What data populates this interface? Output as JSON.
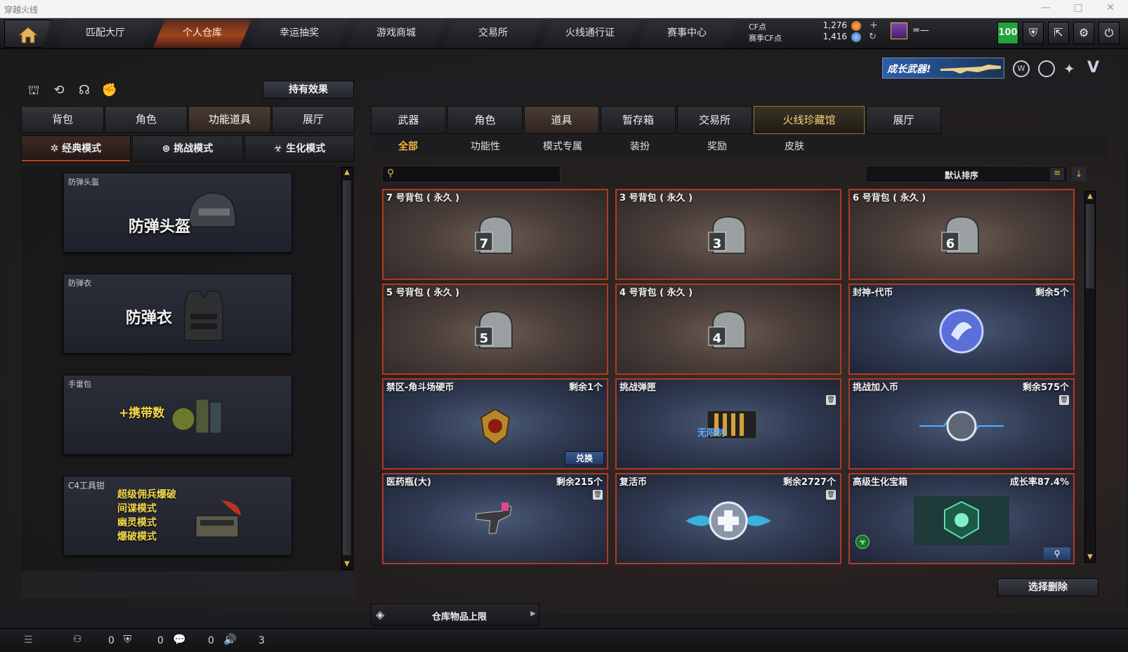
{
  "window": {
    "title": "穿越火线",
    "minimize": "—",
    "maximize": "□",
    "close": "✕"
  },
  "nav": {
    "tabs": [
      "匹配大厅",
      "个人仓库",
      "幸运抽奖",
      "游戏商城",
      "交易所",
      "火线通行证",
      "赛事中心"
    ],
    "active": "个人仓库",
    "cf_label": "CF点",
    "season_cf_label": "赛季CF点",
    "cf_value": "1,276",
    "season_cf_value": "1,416",
    "rank_text": "=—",
    "level_badge": "100"
  },
  "banner": {
    "text": "成长武器!"
  },
  "left": {
    "effect_button": "持有效果",
    "tabs": [
      "背包",
      "角色",
      "功能道具",
      "展厅"
    ],
    "active_tab": "功能道具",
    "modes": [
      "经典模式",
      "挑战模式",
      "生化模式"
    ],
    "active_mode": "经典模式",
    "cards": [
      {
        "label": "防弹头盔",
        "title": "防弹头盔"
      },
      {
        "label": "防弹衣",
        "title": "防弹衣"
      },
      {
        "label": "手雷包",
        "title": "+携带数"
      },
      {
        "label": "C4工具钳",
        "lines": [
          "超级佣兵爆破",
          "间谍模式",
          "幽灵模式",
          "爆破模式"
        ]
      }
    ]
  },
  "right": {
    "tabs": [
      "武器",
      "角色",
      "道具",
      "暂存箱",
      "交易所",
      "火线珍藏馆",
      "展厅"
    ],
    "active_tab": "道具",
    "subtabs": [
      "全部",
      "功能性",
      "模式专属",
      "装扮",
      "奖励",
      "皮肤"
    ],
    "active_subtab": "全部",
    "search_placeholder": "",
    "sort_label": "默认排序",
    "items": [
      {
        "name": "7 号背包 ( 永久 )",
        "count": "",
        "bag": "7",
        "style": "brown"
      },
      {
        "name": "3 号背包 ( 永久 )",
        "count": "",
        "bag": "3",
        "style": "brown"
      },
      {
        "name": "6 号背包 ( 永久 )",
        "count": "",
        "bag": "6",
        "style": "brown"
      },
      {
        "name": "5 号背包 ( 永久 )",
        "count": "",
        "bag": "5",
        "style": "brown"
      },
      {
        "name": "4 号背包 ( 永久 )",
        "count": "",
        "bag": "4",
        "style": "brown"
      },
      {
        "name": "封神-代币",
        "count": "剩余5个",
        "style": "blue"
      },
      {
        "name": "禁区-角斗场硬币",
        "count": "剩余1个",
        "style": "blue",
        "button": "兑换"
      },
      {
        "name": "挑战弹匣",
        "count": "",
        "style": "blue",
        "art_text": "无限制"
      },
      {
        "name": "挑战加入币",
        "count": "剩余575个",
        "style": "blue"
      },
      {
        "name": "医药瓶(大)",
        "count": "剩余215个",
        "style": "blue"
      },
      {
        "name": "复活币",
        "count": "剩余2727个",
        "style": "blue"
      },
      {
        "name": "高级生化宝箱",
        "count": "成长率87.4%",
        "style": "blue"
      }
    ],
    "delete_button": "选择删除",
    "storage_limit": "仓库物品上限"
  },
  "status": {
    "v1": "0",
    "v2": "0",
    "v3": "0",
    "v4": "3"
  },
  "colors": {
    "accent": "#b13a20",
    "gold": "#f0b33b",
    "green_badge": "#22a33a"
  }
}
